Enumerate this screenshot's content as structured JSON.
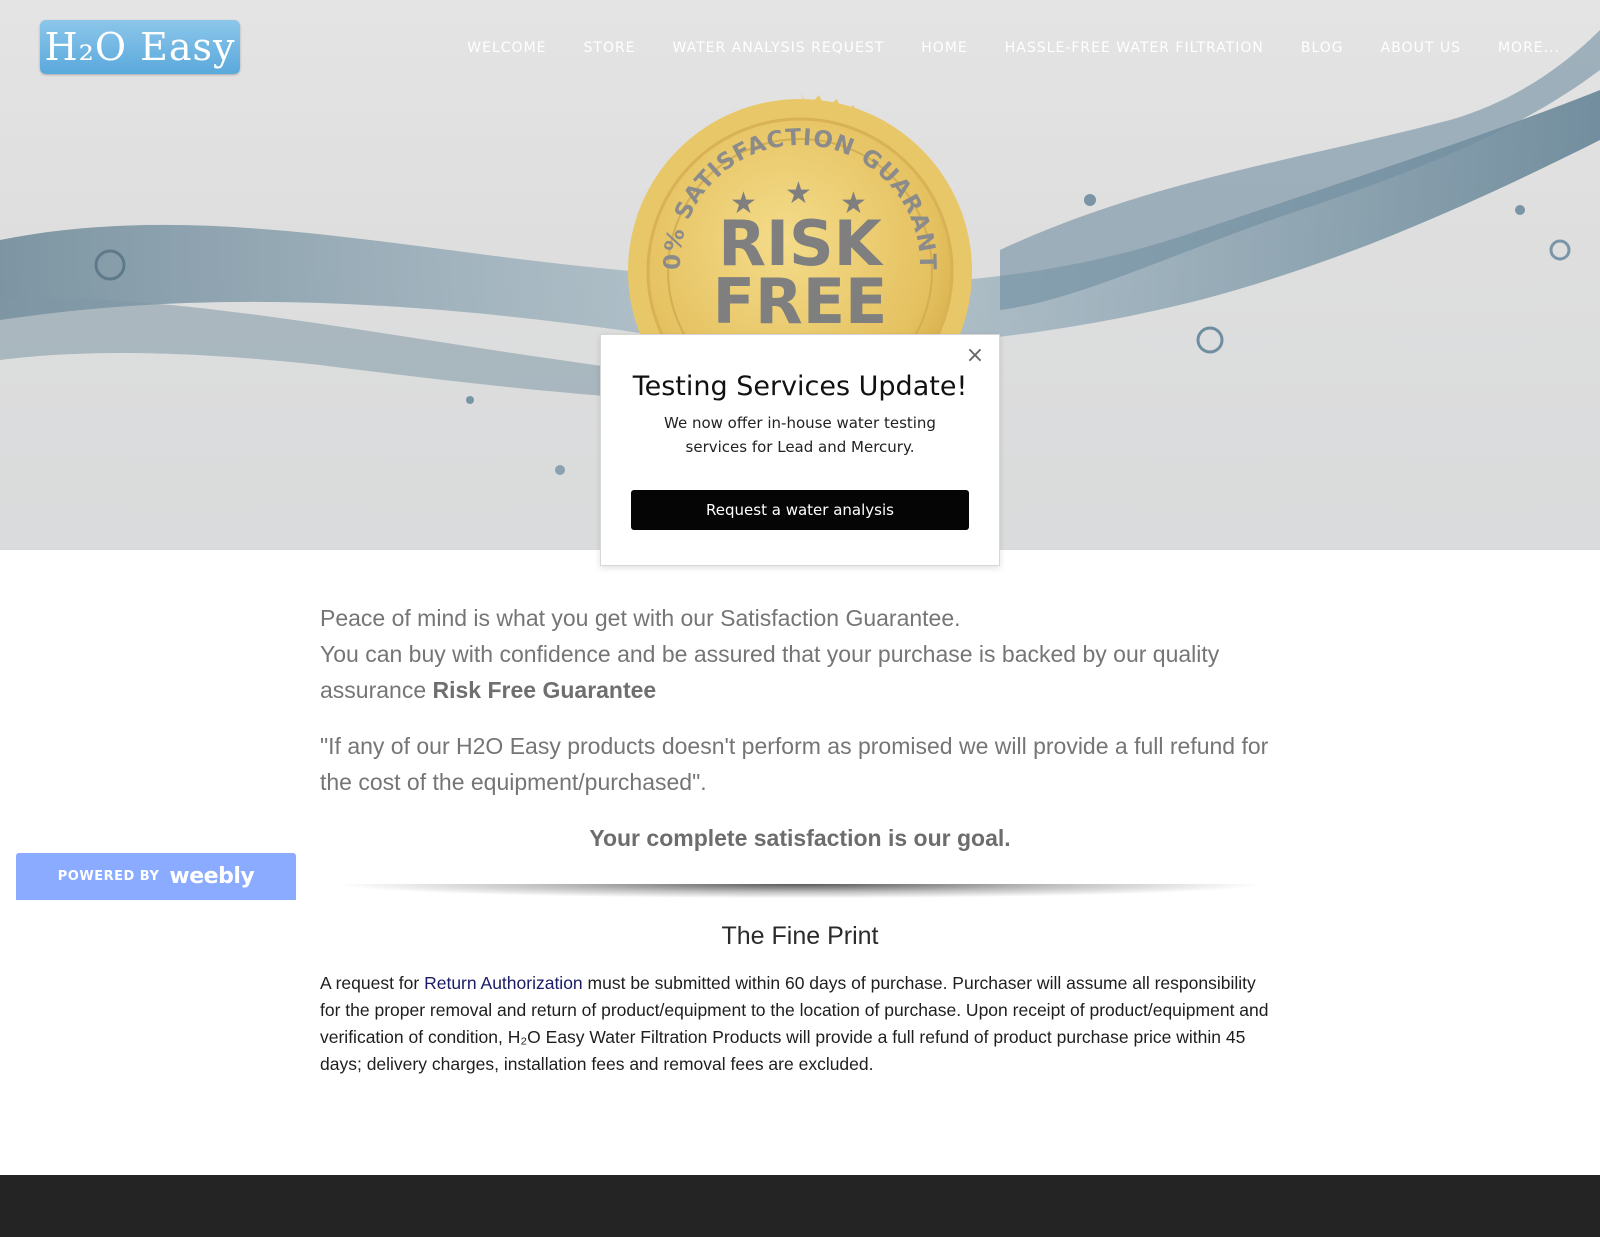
{
  "site": {
    "logo_text": "H₂O Easy",
    "nav": [
      {
        "label": "WELCOME"
      },
      {
        "label": "STORE"
      },
      {
        "label": "WATER ANALYSIS REQUEST"
      },
      {
        "label": "HOME"
      },
      {
        "label": "HASSLE-FREE WATER FILTRATION"
      },
      {
        "label": "BLOG"
      },
      {
        "label": "ABOUT US"
      },
      {
        "label": "MORE..."
      }
    ]
  },
  "hero": {
    "seal": {
      "arc_text": "100% SATISFACTION GUARANTEE",
      "line1": "RISK",
      "line2": "FREE",
      "color_gold": "#e7c86a",
      "color_gray": "#7f7f7f"
    }
  },
  "modal": {
    "close_symbol": "×",
    "title": "Testing Services Update!",
    "text": "We now offer in-house water testing services for Lead and Mercury.",
    "button_label": "Request a water analysis"
  },
  "content": {
    "lead_line1": "Peace of mind is what you get with our Satisfaction Guarantee.",
    "lead_line2_prefix": "You can buy with confidence and be assured that your purchase is backed by our quality assurance ",
    "lead_line2_bold": "Risk Free Guarantee",
    "quote": "\"If any of our H2O Easy products doesn't perform as promised we will provide a full refund for the cost of the equipment/purchased\".",
    "goal": "Your complete satisfaction is our goal."
  },
  "fine_print": {
    "title": "The Fine Print",
    "text_before_link": "A request for ",
    "link_text": "Return Authorization",
    "text_after_link": " must be submitted within 60 days of purchase. Purchaser will assume all responsibility for the proper removal and return of product/equipment to the location of purchase. Upon receipt of product/equipment and verification of condition, H₂O Easy Water Filtration Products will provide a full refund of  product purchase price within 45 days; delivery charges, installation fees and removal fees are excluded."
  },
  "badge": {
    "powered_by": "POWERED BY",
    "brand": "weebly",
    "color": "#8aabff"
  },
  "colors": {
    "footer": "#242424",
    "hero_bg": "#e2e2e2",
    "water": "#8fa9b8"
  }
}
